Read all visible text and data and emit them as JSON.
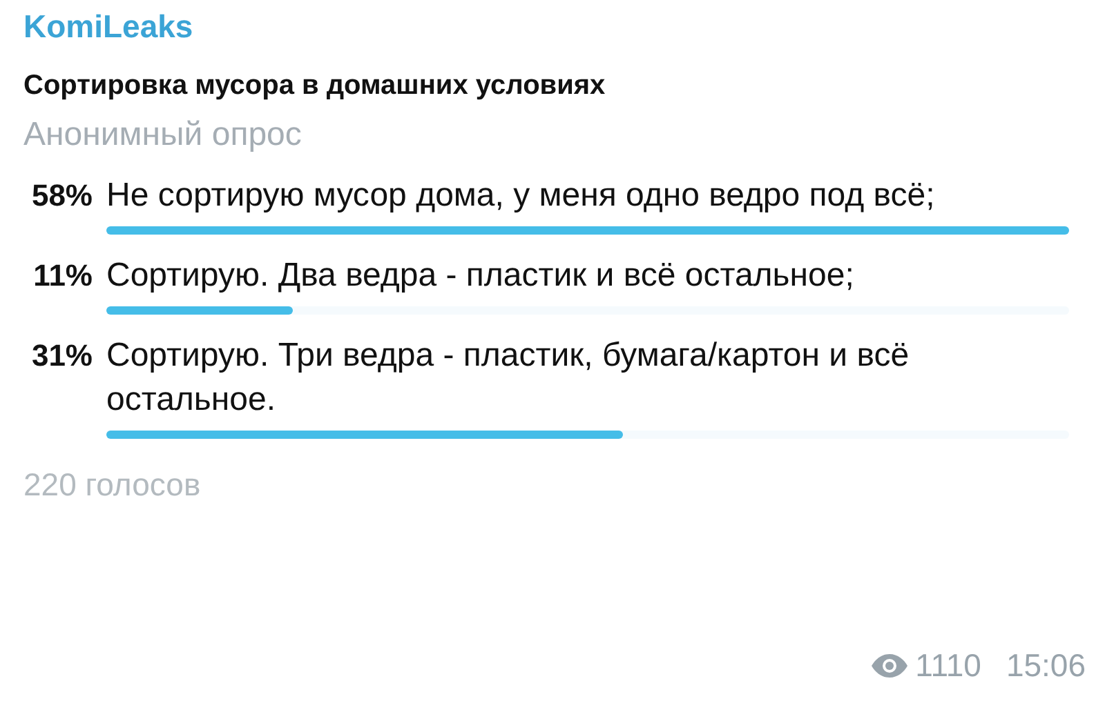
{
  "channel": "KomiLeaks",
  "poll": {
    "question": "Сортировка мусора в домашних условиях",
    "type_label": "Анонимный опрос",
    "options": [
      {
        "percent": "58%",
        "text": "Не сортирую мусор дома, у меня одно ведро под всё;",
        "level": 1
      },
      {
        "percent": "11%",
        "text": "Сортирую. Два ведра - пластик и всё остальное;",
        "level": 0.194
      },
      {
        "percent": "31%",
        "text": "Сортирую. Три ведра - пластик, бумага/картон и всё остальное.",
        "level": 0.537
      }
    ],
    "votes": "220 голосов"
  },
  "footer": {
    "views": "1110",
    "time": "15:06"
  }
}
